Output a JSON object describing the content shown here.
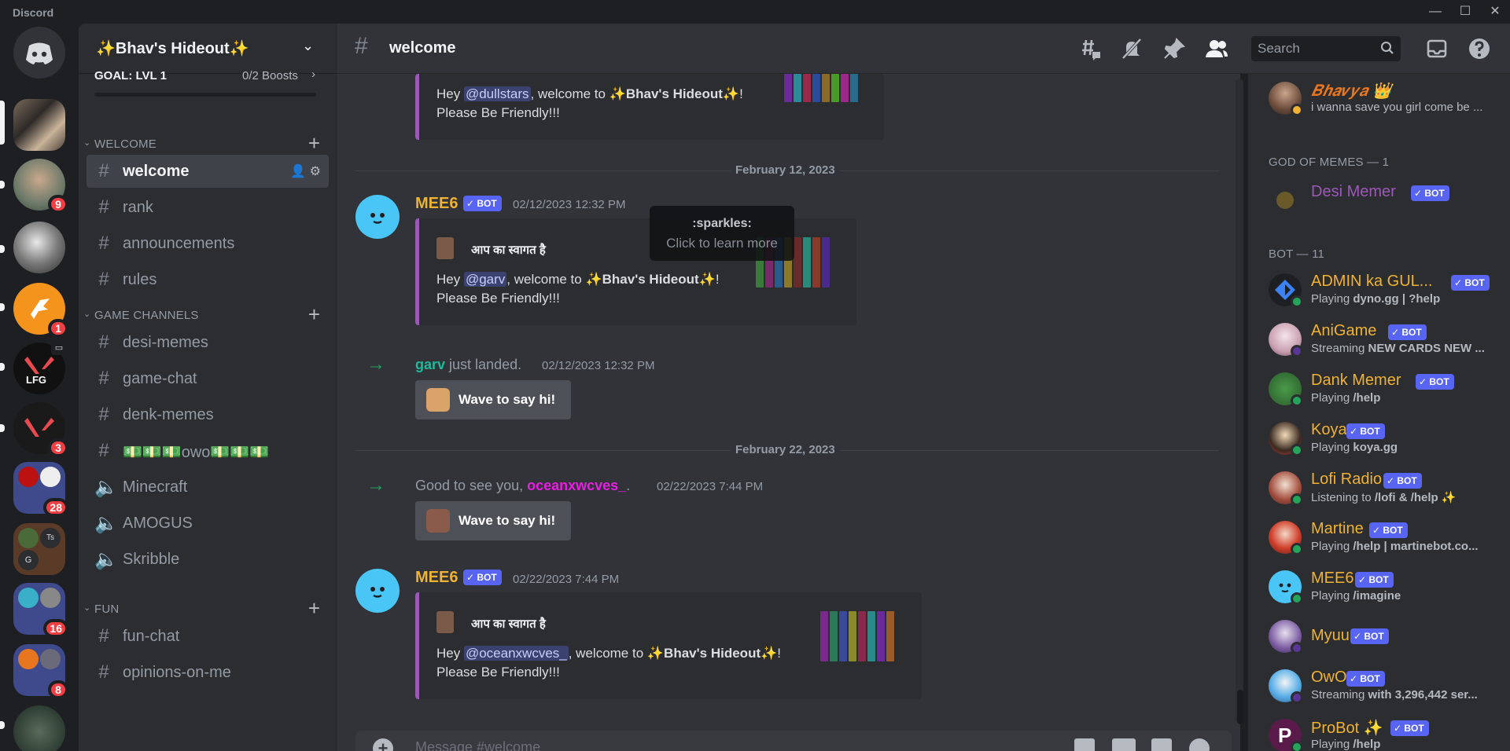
{
  "window": {
    "app_name": "Discord",
    "minimize": "—",
    "maximize": "☐",
    "close": "✕"
  },
  "servers": [
    {
      "name": "home",
      "badge": ""
    },
    {
      "name": "s1",
      "badge": ""
    },
    {
      "name": "s2",
      "badge": "9"
    },
    {
      "name": "s3",
      "badge": ""
    },
    {
      "name": "s4",
      "badge": "1"
    },
    {
      "name": "s5",
      "badge": ""
    },
    {
      "name": "s6",
      "badge": "3"
    },
    {
      "name": "s7",
      "badge": "28"
    },
    {
      "name": "s8",
      "badge": ""
    },
    {
      "name": "s9",
      "badge": "16"
    },
    {
      "name": "s10",
      "badge": "8"
    },
    {
      "name": "s11",
      "badge": ""
    }
  ],
  "server_labels": {
    "lfg": "LFG",
    "ts": "Ts",
    "g": "G"
  },
  "guild": {
    "name": "✨Bhav's Hideout✨",
    "goal": "GOAL: LVL 1",
    "boosts": "0/2 Boosts",
    "boost_progress": 0
  },
  "categories": {
    "welcome": "WELCOME",
    "game": "GAME CHANNELS",
    "fun": "FUN"
  },
  "channels": {
    "welcome": "welcome",
    "rank": "rank",
    "announcements": "announcements",
    "rules": "rules",
    "desi_memes": "desi-memes",
    "game_chat": "game-chat",
    "denk_memes": "denk-memes",
    "owo": "💵💵💵owo💵💵💵",
    "minecraft": "Minecraft",
    "amogus": "AMOGUS",
    "skribble": "Skribble",
    "fun_chat": "fun-chat",
    "opinions": "opinions-on-me"
  },
  "header": {
    "channel": "welcome",
    "search_placeholder": "Search"
  },
  "messages": {
    "embed0": {
      "line1_pre": "Hey ",
      "mention": "@dullstars",
      "line1_mid": ", welcome to ",
      "server": "✨Bhav's Hideout✨",
      "line1_post": "!",
      "line2": "Please Be Friendly!!!"
    },
    "date1": "February 12, 2023",
    "mee6_1": {
      "author": "MEE6",
      "bot": "✓ BOT",
      "time": "02/12/2023 12:32 PM",
      "embed_author": "आप का स्वागत है",
      "line1_pre": "Hey ",
      "mention": "@garv",
      "line1_mid": ", welcome to ",
      "server": "✨Bhav's Hideout✨",
      "line1_post": "!",
      "line2": "Please Be Friendly!!!"
    },
    "tooltip": {
      "title": ":sparkles:",
      "subtitle": "Click to learn more"
    },
    "join1": {
      "user": "garv",
      "text": " just landed.",
      "time": "02/12/2023 12:32 PM",
      "button": "Wave to say hi!"
    },
    "date2": "February 22, 2023",
    "join2": {
      "text": "Good to see you, ",
      "user": "oceanxwcves_",
      "post": ".",
      "time": "02/22/2023 7:44 PM",
      "button": "Wave to say hi!"
    },
    "mee6_2": {
      "author": "MEE6",
      "bot": "✓ BOT",
      "time": "02/22/2023 7:44 PM",
      "embed_author": "आप का स्वागत है",
      "line1_pre": "Hey ",
      "mention": "@oceanxwcves_",
      "line1_mid": ", welcome to ",
      "server": "✨Bhav's Hideout✨",
      "line1_post": "!",
      "line2": "Please Be Friendly!!!"
    }
  },
  "composer": {
    "placeholder": "Message #welcome"
  },
  "members": {
    "top_member": {
      "name": "𝑩𝒉𝒂𝒗𝒚𝒂 👑",
      "sub": "i wanna save you girl come be ..."
    },
    "section_memes": "GOD OF MEMES — 1",
    "desi_memer": {
      "name": "Desi Memer",
      "bot": "✓ BOT"
    },
    "section_bot": "BOT — 11",
    "bots": [
      {
        "name": "ADMIN ka GUL...",
        "bot": "✓ BOT",
        "activity": "Playing ",
        "detail": "dyno.gg | ?help"
      },
      {
        "name": "AniGame",
        "bot": "✓ BOT",
        "activity": "Streaming ",
        "detail": "NEW CARDS NEW ..."
      },
      {
        "name": "Dank Memer",
        "bot": "✓ BOT",
        "activity": "Playing ",
        "detail": "/help"
      },
      {
        "name": "Koya",
        "bot": "✓ BOT",
        "activity": "Playing ",
        "detail": "koya.gg"
      },
      {
        "name": "Lofi Radio",
        "bot": "✓ BOT",
        "activity": "Listening to ",
        "detail": "/lofi & /help ✨"
      },
      {
        "name": "Martine",
        "bot": "✓ BOT",
        "activity": "Playing ",
        "detail": "/help | martinebot.co..."
      },
      {
        "name": "MEE6",
        "bot": "✓ BOT",
        "activity": "Playing ",
        "detail": "/imagine"
      },
      {
        "name": "Myuu",
        "bot": "✓ BOT",
        "activity": "",
        "detail": ""
      },
      {
        "name": "OwO",
        "bot": "✓ BOT",
        "activity": "Streaming ",
        "detail": "with 3,296,442 ser..."
      },
      {
        "name": "ProBot ✨",
        "bot": "✓ BOT",
        "activity": "Playing ",
        "detail": "/help"
      }
    ]
  },
  "colors": {
    "blurple": "#5865f2",
    "bot_name": "#f0b232",
    "online": "#23a55a",
    "danger": "#f23f43",
    "embed_border": "#9b59b6",
    "join_user": "#1abc9c",
    "ocean_user": "#e91ee3",
    "memer": "#9b59b6"
  }
}
